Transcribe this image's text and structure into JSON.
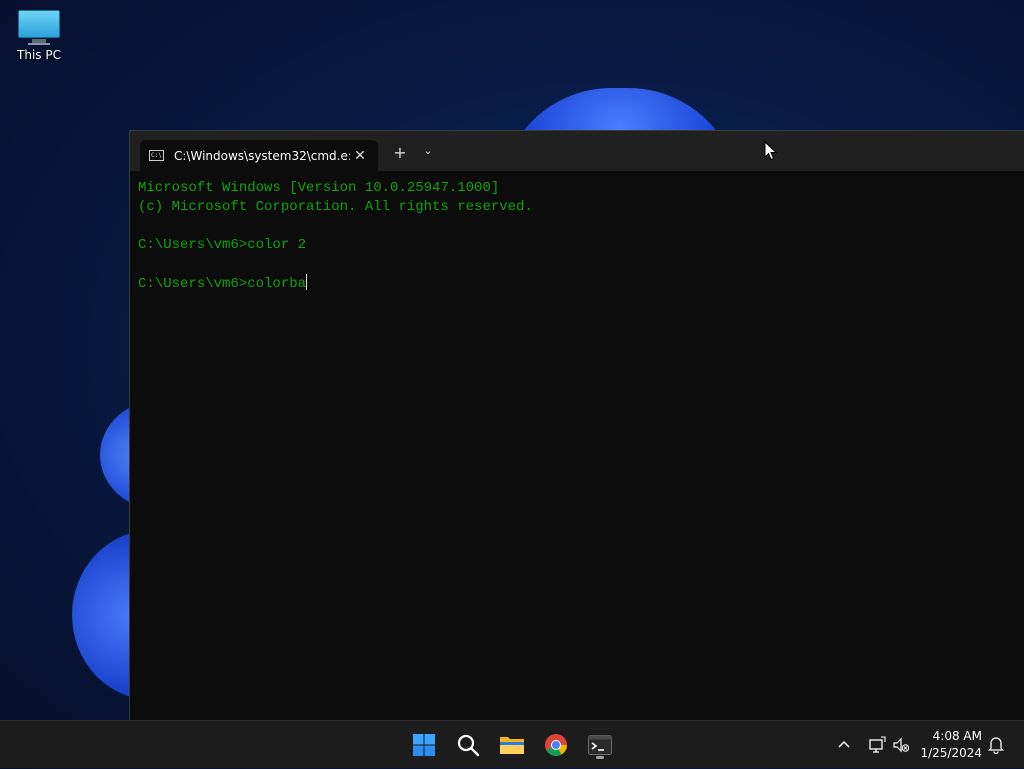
{
  "desktop": {
    "icons": [
      {
        "label": "This PC",
        "icon": "monitor-icon"
      }
    ]
  },
  "terminal": {
    "tab_title": "C:\\Windows\\system32\\cmd.e:",
    "tab_close": "✕",
    "new_tab": "+",
    "tab_menu": "⌄",
    "lines": [
      "Microsoft Windows [Version 10.0.25947.1000]",
      "(c) Microsoft Corporation. All rights reserved.",
      "",
      "C:\\Users\\vm6>color 2",
      "",
      "C:\\Users\\vm6>colorba"
    ],
    "text_color": "#13a10e"
  },
  "taskbar": {
    "apps": [
      "windows-start-icon",
      "search-icon",
      "file-explorer-icon",
      "chrome-icon",
      "terminal-icon"
    ],
    "clock": {
      "time": "4:08 AM",
      "date": "1/25/2024"
    }
  }
}
